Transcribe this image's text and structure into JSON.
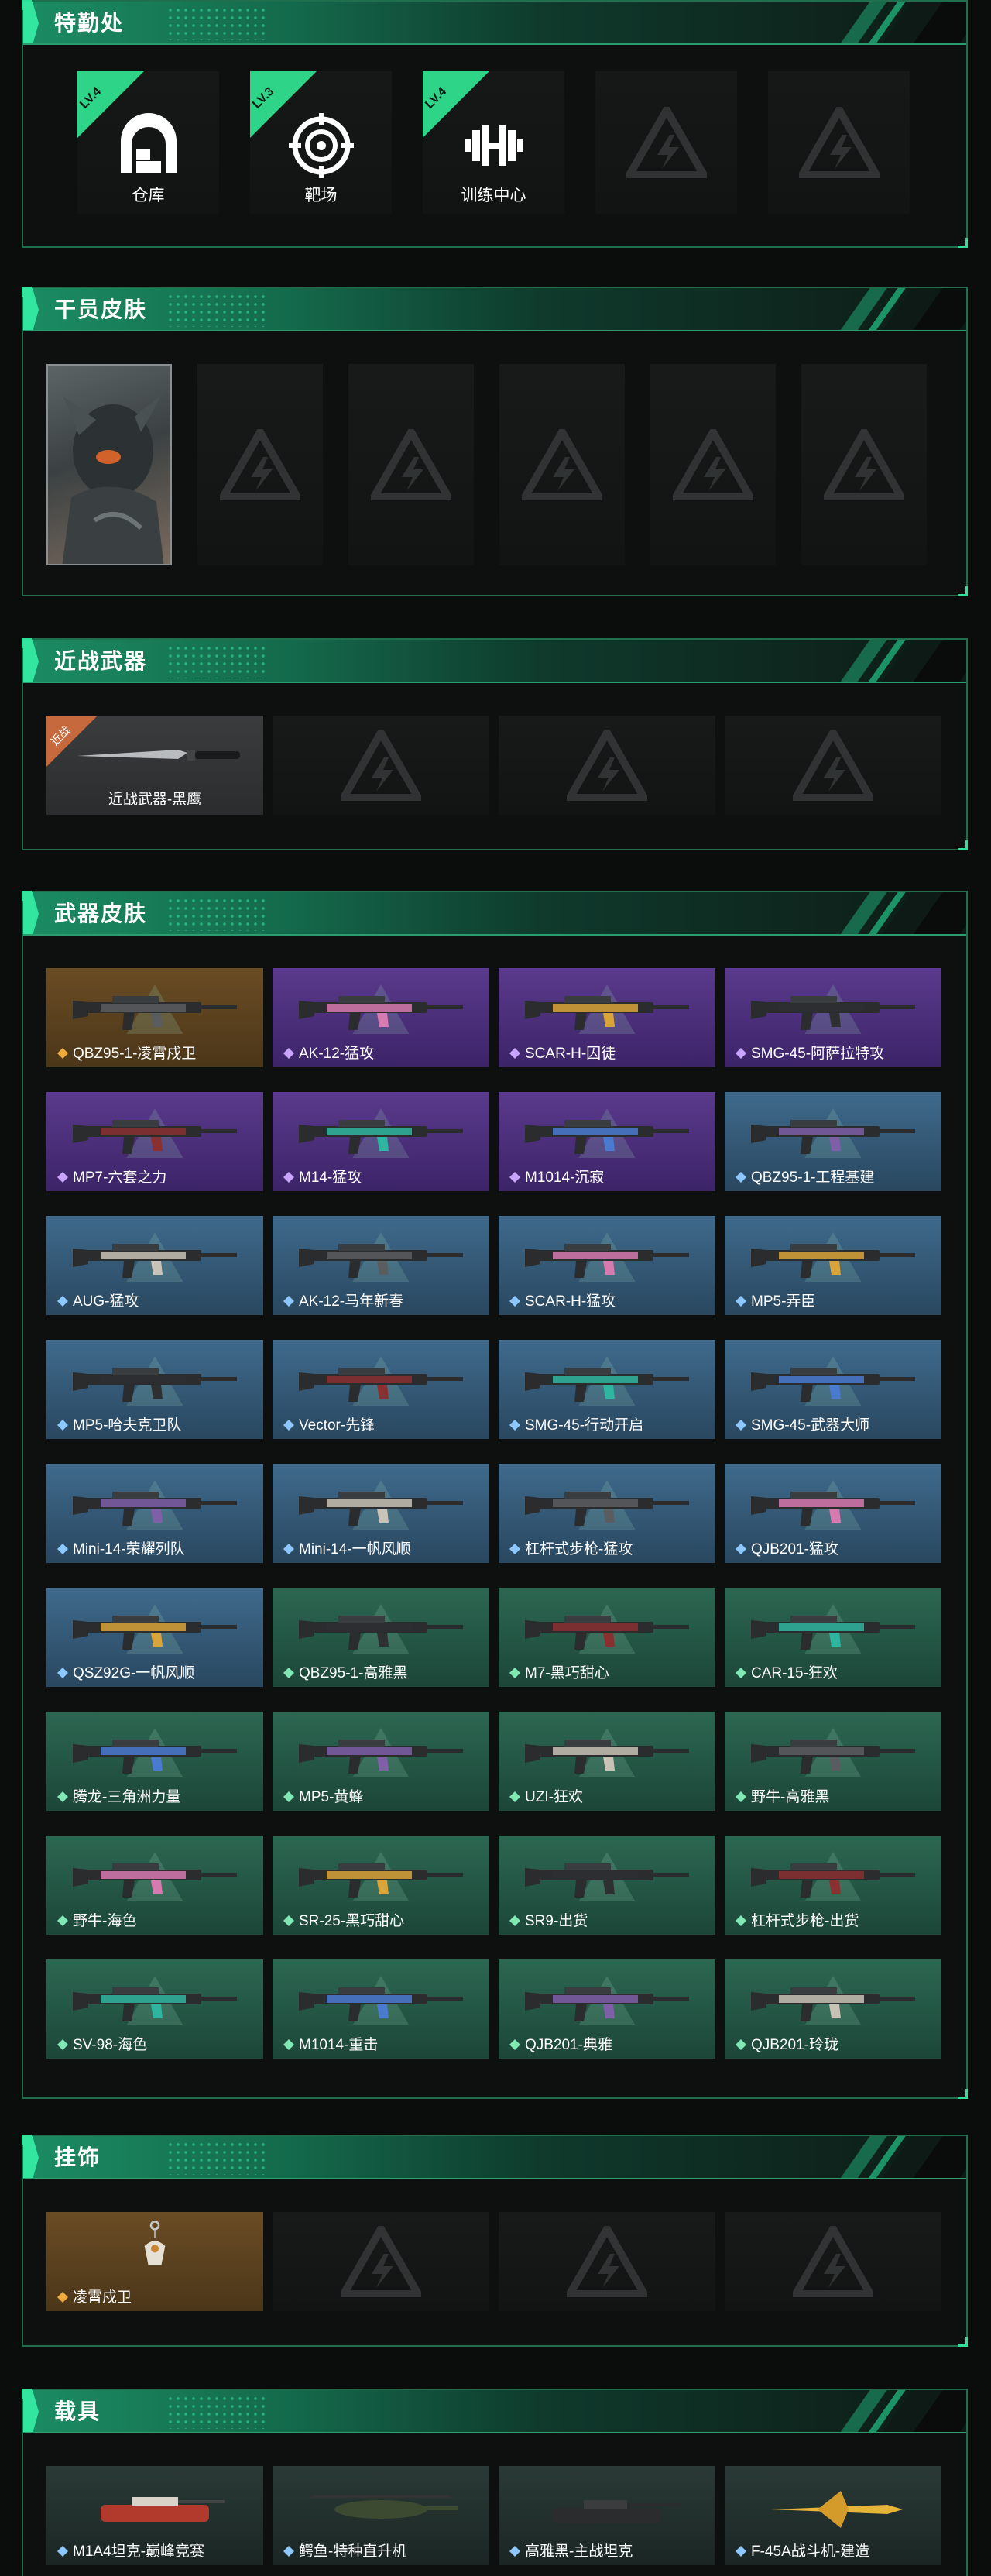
{
  "sections": {
    "facilities": {
      "title": "特勤处"
    },
    "operator_skins": {
      "title": "干员皮肤"
    },
    "melee": {
      "title": "近战武器"
    },
    "weapon_skins": {
      "title": "武器皮肤"
    },
    "charms": {
      "title": "挂饰"
    },
    "vehicles": {
      "title": "载具"
    }
  },
  "facilities": [
    {
      "name": "仓库",
      "level": "LV.4",
      "icon": "warehouse-icon"
    },
    {
      "name": "靶场",
      "level": "LV.3",
      "icon": "target-icon"
    },
    {
      "name": "训练中心",
      "level": "LV.4",
      "icon": "dumbbell-icon"
    }
  ],
  "melee": {
    "tag": "近战",
    "name": "近战武器-黑鹰"
  },
  "weapon_skins": [
    {
      "name": "QBZ95-1-凌霄戍卫",
      "rarity": "gold"
    },
    {
      "name": "AK-12-猛攻",
      "rarity": "purple"
    },
    {
      "name": "SCAR-H-囚徒",
      "rarity": "purple"
    },
    {
      "name": "SMG-45-阿萨拉特攻",
      "rarity": "purple"
    },
    {
      "name": "MP7-六套之力",
      "rarity": "purple"
    },
    {
      "name": "M14-猛攻",
      "rarity": "purple"
    },
    {
      "name": "M1014-沉寂",
      "rarity": "purple"
    },
    {
      "name": "QBZ95-1-工程基建",
      "rarity": "blue"
    },
    {
      "name": "AUG-猛攻",
      "rarity": "blue"
    },
    {
      "name": "AK-12-马年新春",
      "rarity": "blue"
    },
    {
      "name": "SCAR-H-猛攻",
      "rarity": "blue"
    },
    {
      "name": "MP5-弄臣",
      "rarity": "blue"
    },
    {
      "name": "MP5-哈夫克卫队",
      "rarity": "blue"
    },
    {
      "name": "Vector-先锋",
      "rarity": "blue"
    },
    {
      "name": "SMG-45-行动开启",
      "rarity": "blue"
    },
    {
      "name": "SMG-45-武器大师",
      "rarity": "blue"
    },
    {
      "name": "Mini-14-荣耀列队",
      "rarity": "blue"
    },
    {
      "name": "Mini-14-一帆风顺",
      "rarity": "blue"
    },
    {
      "name": "杠杆式步枪-猛攻",
      "rarity": "blue"
    },
    {
      "name": "QJB201-猛攻",
      "rarity": "blue"
    },
    {
      "name": "QSZ92G-一帆风顺",
      "rarity": "blue"
    },
    {
      "name": "QBZ95-1-高雅黑",
      "rarity": "green"
    },
    {
      "name": "M7-黑巧甜心",
      "rarity": "green"
    },
    {
      "name": "CAR-15-狂欢",
      "rarity": "green"
    },
    {
      "name": "腾龙-三角洲力量",
      "rarity": "green"
    },
    {
      "name": "MP5-黄蜂",
      "rarity": "green"
    },
    {
      "name": "UZI-狂欢",
      "rarity": "green"
    },
    {
      "name": "野牛-高雅黑",
      "rarity": "green"
    },
    {
      "name": "野牛-海色",
      "rarity": "green"
    },
    {
      "name": "SR-25-黑巧甜心",
      "rarity": "green"
    },
    {
      "name": "SR9-出货",
      "rarity": "green"
    },
    {
      "name": "杠杆式步枪-出货",
      "rarity": "green"
    },
    {
      "name": "SV-98-海色",
      "rarity": "green"
    },
    {
      "name": "M1014-重击",
      "rarity": "green"
    },
    {
      "name": "QJB201-典雅",
      "rarity": "green"
    },
    {
      "name": "QJB201-玲珑",
      "rarity": "green"
    }
  ],
  "charms": [
    {
      "name": "凌霄戍卫",
      "rarity": "gold"
    }
  ],
  "vehicles": [
    {
      "name": "M1A4坦克-巅峰竞赛",
      "rarity": "dark"
    },
    {
      "name": "鳄鱼-特种直升机",
      "rarity": "dark"
    },
    {
      "name": "高雅黑-主战坦克",
      "rarity": "dark"
    },
    {
      "name": "F-45A战斗机-建造",
      "rarity": "dark"
    }
  ],
  "colors": {
    "accent": "#2fe09a",
    "gold": "#6a4c24",
    "purple": "#5a3a8c",
    "blue": "#3f6a8c",
    "green": "#2c6752"
  }
}
